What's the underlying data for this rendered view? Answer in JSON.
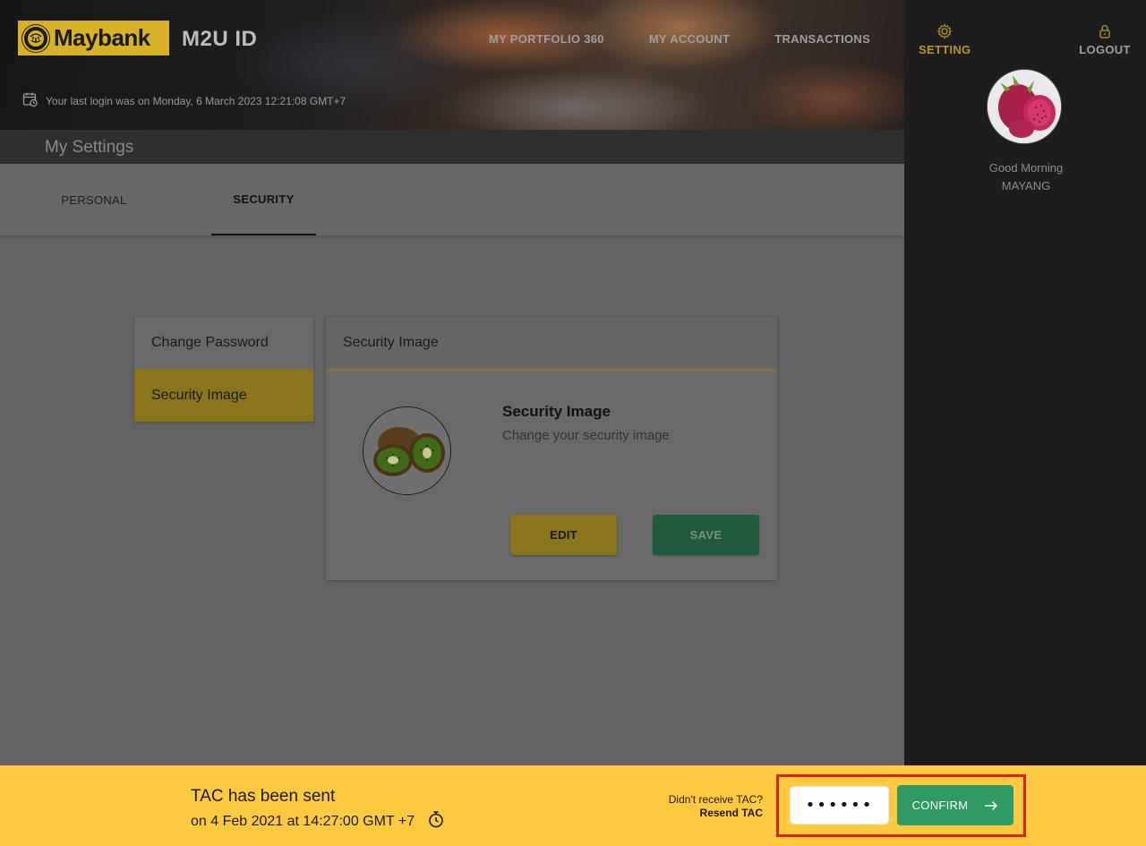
{
  "header": {
    "logo_text": "Maybank",
    "app_title": "M2U ID",
    "nav": [
      "MY PORTFOLIO 360",
      "MY ACCOUNT",
      "TRANSACTIONS"
    ],
    "last_login": "Your last login was on Monday, 6 March 2023 12:21:08 GMT+7"
  },
  "right_panel": {
    "setting_label": "SETTING",
    "logout_label": "LOGOUT",
    "greeting": "Good Morning",
    "username": "MAYANG"
  },
  "page": {
    "title": "My Settings",
    "tabs": [
      "PERSONAL",
      "SECURITY"
    ],
    "active_tab": "SECURITY"
  },
  "security_menu": {
    "items": [
      "Change Password",
      "Security Image"
    ],
    "active_item": "Security Image"
  },
  "security_card": {
    "header": "Security Image",
    "title": "Security Image",
    "subtitle": "Change your security image",
    "edit_label": "EDIT",
    "save_label": "SAVE"
  },
  "tac": {
    "title": "TAC has been sent",
    "time": "on 4 Feb 2021 at 14:27:00 GMT +7",
    "not_received": "Didn't receive TAC?",
    "resend_label": "Resend TAC",
    "input_value": "••••••",
    "confirm_label": "CONFIRM"
  },
  "colors": {
    "brand_yellow": "#fdc93e",
    "confirm_green": "#2f9a63",
    "highlight_red": "#e0201c"
  }
}
